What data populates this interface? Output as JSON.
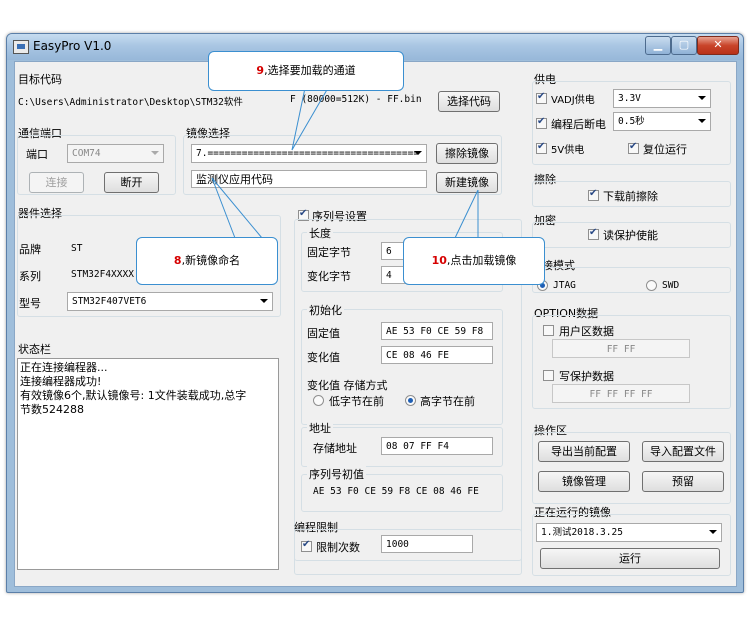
{
  "window": {
    "title": "EasyPro V1.0"
  },
  "target_code": {
    "label": "目标代码",
    "path": "C:\\Users\\Administrator\\Desktop\\STM32软件",
    "size_info": "F (80000=512K) - FF.bin",
    "select_button": "选择代码"
  },
  "comm_port": {
    "label": "通信端口",
    "port_label": "端口",
    "port_value": "COM74",
    "connect_button": "连接",
    "disconnect_button": "断开"
  },
  "image_select": {
    "label": "镜像选择",
    "combo_value": "7.=====================================",
    "name_value": "监测仪应用代码",
    "erase_button": "擦除镜像",
    "new_button": "新建镜像"
  },
  "device": {
    "label": "器件选择",
    "brand_label": "品牌",
    "brand_value": "ST",
    "series_label": "系列",
    "series_value": "STM32F4XXXX",
    "model_label": "型号",
    "model_value": "STM32F407VET6"
  },
  "status": {
    "label": "状态栏",
    "lines": [
      "正在连接编程器...",
      "连接编程器成功!",
      "有效镜像6个,默认镜像号: 1文件装载成功,总字",
      "节数524288"
    ]
  },
  "serial": {
    "label": "序列号设置",
    "checked": true,
    "length_label": "长度",
    "fixed_bytes_label": "固定字节",
    "fixed_bytes_value": "6",
    "var_bytes_label": "变化字节",
    "var_bytes_value": "4",
    "init_label": "初始化",
    "fixed_value_label": "固定值",
    "fixed_value": "AE 53 F0 CE 59 F8",
    "var_value_label": "变化值",
    "var_value": "CE 08 46 FE",
    "storage_label": "变化值 存储方式",
    "low_first": "低字节在前",
    "high_first": "高字节在前",
    "address_group": "地址",
    "storage_addr_label": "存储地址",
    "storage_addr_value": "08 07 FF F4",
    "init_value_label": "序列号初值",
    "init_value": "AE 53 F0 CE 59 F8 CE 08 46 FE"
  },
  "limit": {
    "label": "编程限制",
    "count_label": "限制次数",
    "count_checked": true,
    "count_value": "1000"
  },
  "power": {
    "label": "供电",
    "vadj_label": "VADJ供电",
    "vadj_checked": true,
    "vadj_value": "3.3V",
    "off_after_label": "编程后断电",
    "off_after_checked": true,
    "off_after_value": "0.5秒",
    "v5_label": "5V供电",
    "v5_checked": true,
    "reset_label": "复位运行",
    "reset_checked": true
  },
  "erase": {
    "label": "擦除",
    "before_download": "下载前擦除",
    "checked": true
  },
  "encrypt": {
    "label": "加密",
    "read_protect": "读保护使能",
    "checked": true
  },
  "connect_mode": {
    "label": "接模式",
    "jtag": "JTAG",
    "swd": "SWD",
    "selected": "JTAG"
  },
  "option": {
    "label": "OPTION数据",
    "user_data_label": "用户区数据",
    "user_data_value": "FF FF",
    "write_protect_label": "写保护数据",
    "write_protect_value": "FF FF FF FF"
  },
  "operation": {
    "label": "操作区",
    "export_button": "导出当前配置",
    "import_button": "导入配置文件",
    "manage_button": "镜像管理",
    "reserve_button": "预留"
  },
  "running": {
    "label": "正在运行的镜像",
    "value": "1.测试2018.3.25",
    "run_button": "运行"
  },
  "callouts": {
    "c9_num": "9",
    "c9_text": ",选择要加载的通道",
    "c8_num": "8",
    "c8_text": ",新镜像命名",
    "c10_num": "10",
    "c10_text": ",点击加载镜像"
  }
}
